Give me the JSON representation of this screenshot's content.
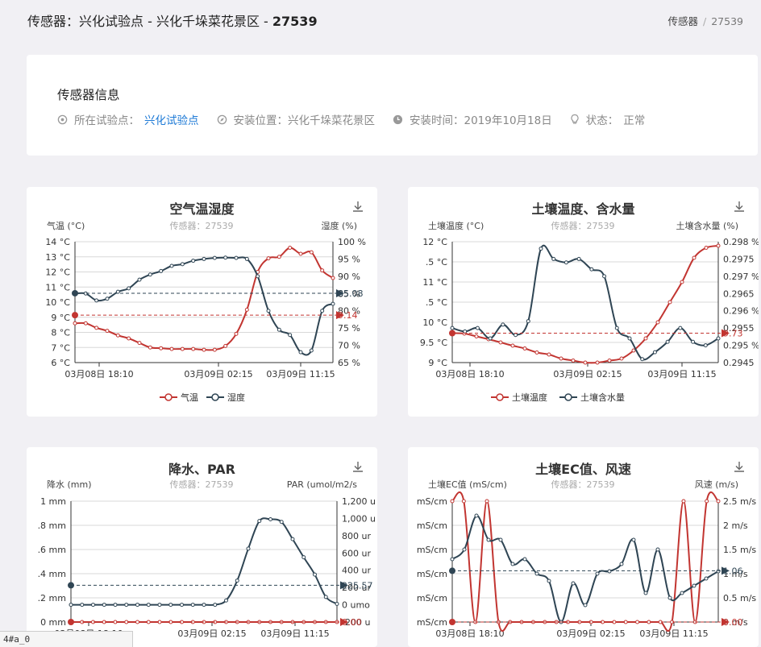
{
  "header": {
    "title_prefix": "传感器：兴化试验点 - 兴化千垛菜花景区 - ",
    "title_id": "27539",
    "breadcrumb": {
      "parent": "传感器",
      "separator": "/",
      "current": "27539"
    }
  },
  "info": {
    "title": "传感器信息",
    "site_label": "所在试验点：",
    "site_value": "兴化试验点",
    "location_label": "安装位置：兴化千垛菜花景区",
    "install_label": "安装时间：2019年10月18日",
    "status_label": "状态：",
    "status_value": "正常",
    "icons": [
      "map-marker-icon",
      "compass-icon",
      "clock-icon",
      "lightbulb-icon"
    ]
  },
  "charts": [
    {
      "title": "空气温湿度",
      "subtitle": "传感器：27539",
      "left_axis_name": "气温 (°C)",
      "right_axis_name": "湿度 (%)",
      "left_ticks": [
        "14 °C",
        "13 °C",
        "12 °C",
        "11 °C",
        "10 °C",
        "9 °C",
        "8 °C",
        "7 °C",
        "6 °C"
      ],
      "right_ticks": [
        "100 %",
        "95 %",
        "90 %",
        "85 %",
        "80 %",
        "75 %",
        "70 %",
        "65 %"
      ],
      "x_ticks": [
        "03月08日 18:10",
        "03月09日 02:15",
        "03月09日 11:15"
      ],
      "legend": [
        "气温",
        "湿度"
      ],
      "markline_labels": [
        "9.14",
        "85.08"
      ]
    },
    {
      "title": "土壤温度、含水量",
      "subtitle": "传感器：27539",
      "left_axis_name": "土壤温度 (°C)",
      "right_axis_name": "土壤含水量 (%)",
      "left_ticks": [
        "12 °C",
        ".5 °C",
        "11 °C",
        ".5 °C",
        "10 °C",
        "9.5 °C",
        "9 °C"
      ],
      "right_ticks": [
        "0.298 %",
        "0.2975",
        "0.297 %",
        "0.2965",
        "0.296 %",
        "0.2955",
        "0.295 %",
        "0.2945"
      ],
      "x_ticks": [
        "03月08日 18:10",
        "03月09日 02:15",
        "03月09日 11:15"
      ],
      "legend": [
        "土壤温度",
        "土壤含水量"
      ],
      "markline_labels": [
        "9.73"
      ]
    },
    {
      "title": "降水、PAR",
      "subtitle": "传感器：27539",
      "left_axis_name": "降水 (mm)",
      "right_axis_name": "PAR (umol/m2/s",
      "left_ticks": [
        "1 mm",
        ".8 mm",
        ".6 mm",
        ".4 mm",
        ".2 mm",
        "0 mm"
      ],
      "right_ticks": [
        "1,200 u",
        "1,000 u",
        "800 ur",
        "600 ur",
        "400 ur",
        "200 ur",
        "0 umo",
        "-200 u"
      ],
      "x_ticks": [
        "03月08日 18:10",
        "03月09日 02:15",
        "03月09日 11:15"
      ],
      "markline_labels": [
        "225.57",
        "0.00"
      ]
    },
    {
      "title": "土壤EC值、风速",
      "subtitle": "传感器：27539",
      "left_axis_name": "土壤EC值 (mS/cm)",
      "right_axis_name": "风速 (m/s)",
      "left_ticks": [
        "mS/cm",
        "mS/cm",
        "mS/cm",
        "mS/cm",
        "mS/cm",
        "mS/cm"
      ],
      "right_ticks": [
        "2.5 m/s",
        "2 m/s",
        "1.5 m/s",
        "1 m/s",
        "0.5 m/s",
        "0 m/s"
      ],
      "x_ticks": [
        "03月08日 18:10",
        "03月09日 02:15",
        "03月09日 11:15"
      ],
      "markline_labels": [
        "1.06",
        "0.00"
      ]
    }
  ],
  "colors": {
    "red": "#c23531",
    "navy": "#2f4554",
    "link": "#1e7ad6",
    "grid": "#cccccc"
  },
  "status_url": "4#a_0",
  "chart_data": [
    {
      "type": "line",
      "title": "空气温湿度",
      "x": [
        "03月08日 18:10",
        "",
        "",
        "",
        "",
        "",
        "",
        "",
        "",
        "",
        "03月09日 02:15",
        "",
        "",
        "",
        "",
        "",
        "",
        "",
        "",
        "",
        "03月09日 11:15",
        "",
        "",
        "",
        "",
        "",
        "",
        "",
        "",
        "",
        ""
      ],
      "series": [
        {
          "name": "气温",
          "axis": "left",
          "unit": "°C",
          "ylim": [
            6,
            14
          ],
          "values": [
            8.6,
            8.6,
            8.3,
            8.1,
            7.8,
            7.6,
            7.3,
            7.0,
            6.95,
            6.9,
            6.9,
            6.9,
            6.85,
            6.85,
            7.1,
            7.9,
            9.5,
            12.0,
            12.9,
            13.0,
            13.6,
            13.2,
            13.3,
            12.1,
            11.6
          ]
        },
        {
          "name": "湿度",
          "axis": "right",
          "unit": "%",
          "ylim": [
            65,
            100
          ],
          "values": [
            85.0,
            85.0,
            83.0,
            83.5,
            85.5,
            86.5,
            89.0,
            90.5,
            91.5,
            93.0,
            93.5,
            94.5,
            95.0,
            95.3,
            95.4,
            95.3,
            95.0,
            90.0,
            80.0,
            74.5,
            73.0,
            68.0,
            68.5,
            80.0,
            82.0
          ]
        }
      ],
      "marklines": [
        {
          "series": "气温",
          "value": 9.14
        },
        {
          "series": "湿度",
          "value": 85.08
        }
      ]
    },
    {
      "type": "line",
      "title": "土壤温度、含水量",
      "x": [
        "03月08日 18:10",
        "03月09日 02:15",
        "03月09日 11:15"
      ],
      "series": [
        {
          "name": "土壤温度",
          "axis": "left",
          "unit": "°C",
          "ylim": [
            9,
            12
          ],
          "values": [
            9.73,
            9.72,
            9.65,
            9.58,
            9.5,
            9.42,
            9.35,
            9.25,
            9.2,
            9.1,
            9.05,
            9.0,
            9.0,
            9.05,
            9.1,
            9.3,
            9.6,
            10.0,
            10.5,
            11.0,
            11.6,
            11.85,
            11.9
          ]
        },
        {
          "name": "土壤含水量",
          "axis": "right",
          "unit": "%",
          "ylim": [
            0.2945,
            0.298
          ],
          "values": [
            0.2955,
            0.2954,
            0.2955,
            0.2952,
            0.2956,
            0.2953,
            0.2957,
            0.2978,
            0.2975,
            0.2974,
            0.2975,
            0.2972,
            0.297,
            0.2955,
            0.2952,
            0.2946,
            0.2948,
            0.2951,
            0.2955,
            0.2951,
            0.295,
            0.2952
          ]
        }
      ],
      "marklines": [
        {
          "series": "土壤温度",
          "value": 9.73
        }
      ]
    },
    {
      "type": "line",
      "title": "降水、PAR",
      "x": [
        "03月08日 18:10",
        "03月09日 02:15",
        "03月09日 11:15"
      ],
      "series": [
        {
          "name": "降水",
          "axis": "left",
          "unit": "mm",
          "ylim": [
            0,
            1
          ],
          "values": [
            0,
            0,
            0,
            0,
            0,
            0,
            0,
            0,
            0,
            0,
            0,
            0,
            0,
            0,
            0,
            0,
            0,
            0,
            0,
            0,
            0,
            0,
            0,
            0,
            0
          ]
        },
        {
          "name": "PAR",
          "axis": "right",
          "unit": "umol/m2/s",
          "ylim": [
            -200,
            1200
          ],
          "values": [
            0,
            0,
            0,
            0,
            0,
            0,
            0,
            0,
            0,
            0,
            0,
            0,
            0,
            0,
            50,
            280,
            650,
            970,
            990,
            960,
            760,
            550,
            350,
            90,
            10
          ]
        }
      ],
      "marklines": [
        {
          "series": "PAR",
          "value": 225.57
        },
        {
          "series": "降水",
          "value": 0.0
        }
      ]
    },
    {
      "type": "line",
      "title": "土壤EC值、风速",
      "x": [
        "03月08日 18:10",
        "03月09日 02:15",
        "03月09日 11:15"
      ],
      "series": [
        {
          "name": "土壤EC值",
          "axis": "left",
          "unit": "mS/cm",
          "ylim": [
            0,
            5
          ],
          "values": [
            5,
            5,
            0,
            5,
            0,
            0,
            0,
            0,
            0,
            0,
            0,
            0,
            0,
            0,
            0,
            0,
            0,
            0,
            0,
            0,
            5,
            0,
            5,
            5
          ]
        },
        {
          "name": "风速",
          "axis": "right",
          "unit": "m/s",
          "ylim": [
            0,
            2.5
          ],
          "values": [
            1.3,
            1.5,
            2.2,
            1.7,
            1.7,
            1.2,
            1.3,
            1.0,
            0.85,
            0.0,
            0.8,
            0.35,
            1.0,
            1.05,
            1.2,
            1.7,
            0.6,
            1.5,
            0.5,
            0.6,
            0.75,
            0.9,
            1.05
          ]
        }
      ],
      "marklines": [
        {
          "series": "风速",
          "value": 1.06
        },
        {
          "series": "土壤EC值",
          "value": 0.0
        }
      ]
    }
  ]
}
